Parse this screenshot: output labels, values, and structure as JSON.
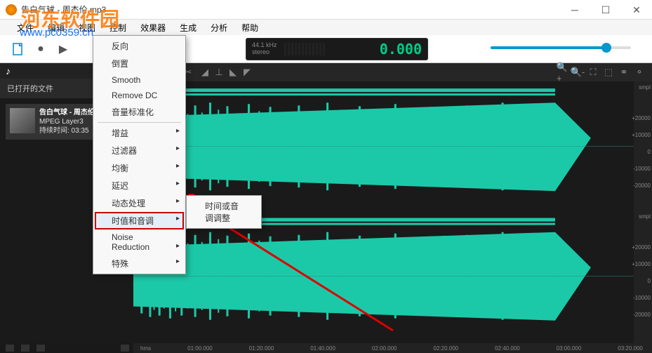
{
  "window": {
    "title": "告白气球 - 周杰伦.mp3"
  },
  "watermark": {
    "text": "河东软件园",
    "url": "www.pc0359.cn"
  },
  "menubar": [
    "文件",
    "编辑",
    "视图",
    "控制",
    "效果器",
    "生成",
    "分析",
    "帮助"
  ],
  "lcd": {
    "rate": "44.1 kHz",
    "mode": "stereo",
    "value": "0.000"
  },
  "left_panel": {
    "header": "已打开的文件",
    "file": {
      "name": "告白气球 - 周杰伦.mp",
      "codec": "MPEG Layer3",
      "duration": "持续时间: 03:35"
    }
  },
  "menu": {
    "items": [
      "反向",
      "倒置",
      "Smooth",
      "Remove DC",
      "音量标准化"
    ],
    "sub_items": [
      "增益",
      "过滤器",
      "均衡",
      "延迟",
      "动态处理",
      "时值和音调",
      "Noise Reduction",
      "特殊"
    ],
    "highlighted": "时值和音调"
  },
  "submenu": {
    "item": "时间或音调调整"
  },
  "timeline": [
    "hms",
    "01:00.000",
    "01:20.000",
    "01:40.000",
    "02:00.000",
    "02:20.000",
    "02:40.000",
    "03:00.000",
    "03:20.000"
  ],
  "ruler": {
    "smpl": "smpl",
    "v1": "+20000",
    "v2": "+10000",
    "v3": "0",
    "v4": "-10000",
    "v5": "-20000",
    "v6": "+20000",
    "v7": "+10000",
    "v8": "0",
    "v9": "-10000",
    "v10": "-20000"
  }
}
